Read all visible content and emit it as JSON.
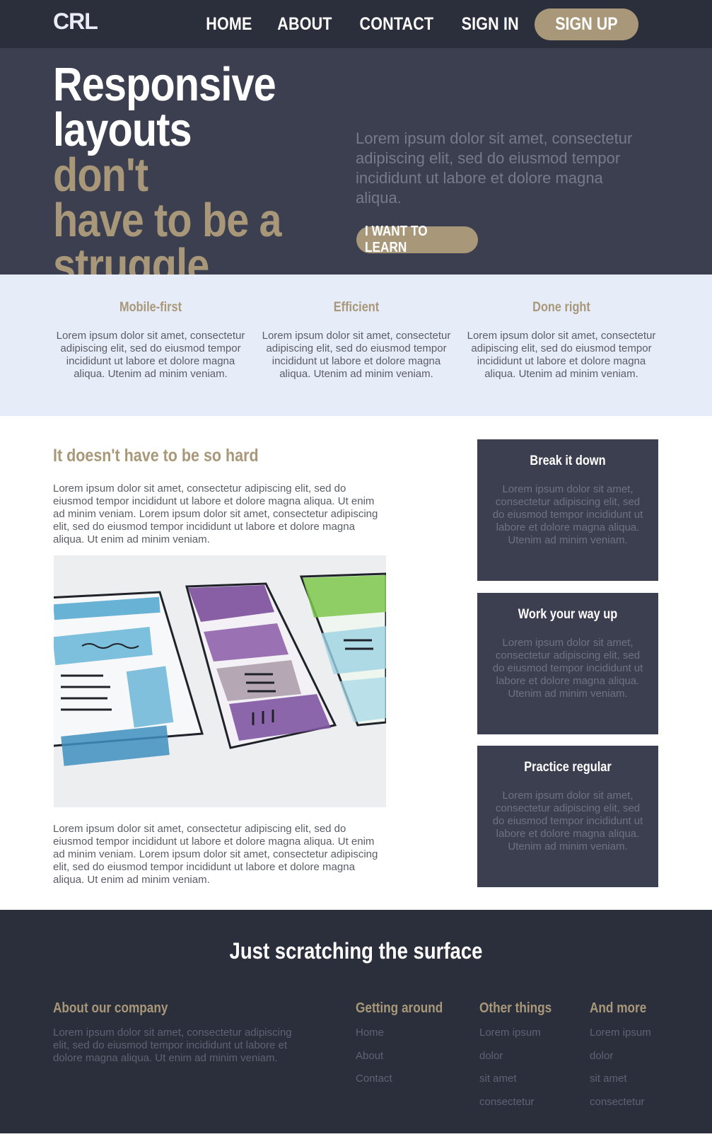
{
  "brand": {
    "logo": "CRL"
  },
  "nav": {
    "items": [
      "HOME",
      "ABOUT",
      "CONTACT",
      "SIGN IN"
    ],
    "signup_label": "SIGN UP"
  },
  "hero": {
    "title_line1": "Responsive",
    "title_line2_white": "layouts ",
    "title_line2_accent": "don't",
    "title_line3": "have to be a",
    "title_line4": "struggle",
    "text": "Lorem ipsum dolor sit amet, consectetur adipiscing elit, sed do eiusmod tempor incididunt ut labore et dolore magna aliqua.",
    "button": "I WANT TO LEARN"
  },
  "features": [
    {
      "title": "Mobile-first",
      "text": "Lorem ipsum dolor sit amet, consectetur adipiscing elit, sed do eiusmod tempor incididunt ut labore et dolore magna aliqua. Utenim ad minim veniam."
    },
    {
      "title": "Efficient",
      "text": "Lorem ipsum dolor sit amet, consectetur adipiscing elit, sed do eiusmod tempor incididunt ut labore et dolore magna aliqua. Utenim ad minim veniam."
    },
    {
      "title": "Done right",
      "text": "Lorem ipsum dolor sit amet, consectetur adipiscing elit, sed do eiusmod tempor incididunt ut labore et dolore magna aliqua. Utenim ad minim veniam."
    }
  ],
  "main": {
    "title": "It doesn't have to be so hard",
    "para1": "Lorem ipsum dolor sit amet, consectetur adipiscing elit, sed do eiusmod tempor incididunt ut labore et dolore magna aliqua. Ut enim ad minim veniam. Lorem ipsum dolor sit amet, consectetur adipiscing elit, sed do eiusmod tempor incididunt ut labore et dolore magna aliqua. Ut enim ad minim veniam.",
    "para2": "Lorem ipsum dolor sit amet, consectetur adipiscing elit, sed do eiusmod tempor incididunt ut labore et dolore magna aliqua. Ut enim ad minim veniam. Lorem ipsum dolor sit amet, consectetur adipiscing elit, sed do eiusmod tempor incididunt ut labore et dolore magna aliqua. Ut enim ad minim veniam."
  },
  "cards": [
    {
      "title": "Break it down",
      "text": "Lorem ipsum dolor sit amet, consectetur adipiscing elit, sed do eiusmod tempor incididunt ut labore et dolore magna aliqua. Utenim ad minim veniam."
    },
    {
      "title": "Work your way up",
      "text": "Lorem ipsum dolor sit amet, consectetur adipiscing elit, sed do eiusmod tempor incididunt ut labore et dolore magna aliqua. Utenim ad minim veniam."
    },
    {
      "title": "Practice regular",
      "text": "Lorem ipsum dolor sit amet, consectetur adipiscing elit, sed do eiusmod tempor incididunt ut labore et dolore magna aliqua. Utenim ad minim veniam."
    }
  ],
  "footer": {
    "title": "Just scratching the surface",
    "about": {
      "title": "About our company",
      "text": "Lorem ipsum dolor sit amet, consectetur adipiscing elit, sed do eiusmod tempor incididunt ut labore et dolore magna aliqua. Ut enim ad minim veniam."
    },
    "getting_around": {
      "title": "Getting around",
      "links": [
        "Home",
        "About",
        "Contact"
      ]
    },
    "other_things": {
      "title": "Other things",
      "links": [
        "Lorem ipsum",
        "dolor",
        "sit amet",
        "consectetur"
      ]
    },
    "and_more": {
      "title": "And more",
      "links": [
        "Lorem ipsum",
        "dolor",
        "sit amet",
        "consectetur"
      ]
    }
  },
  "colors": {
    "nav_bg": "#2b2e3b",
    "hero_bg": "#3c3f4f",
    "accent": "#a89879",
    "features_bg": "#e7ecf9",
    "footer_bg": "#2b2e3b"
  }
}
